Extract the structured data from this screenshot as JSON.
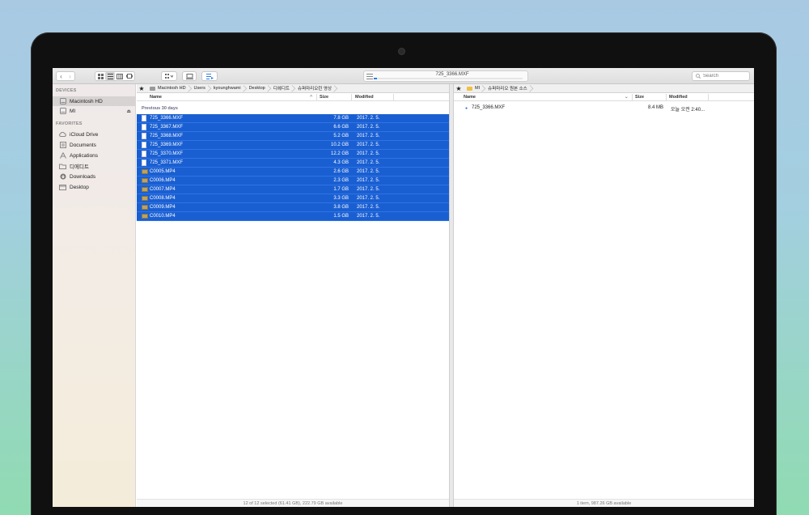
{
  "toolbar": {
    "progress_title": "725_3366.MXF",
    "progress_fraction": 0.02,
    "search_placeholder": "Search"
  },
  "sidebar": {
    "devices_heading": "DEVICES",
    "devices": [
      {
        "label": "Macintosh HD",
        "icon": "hard-drive-icon"
      },
      {
        "label": "MI",
        "icon": "external-drive-icon"
      }
    ],
    "favorites_heading": "FAVORITES",
    "favorites": [
      {
        "label": "iCloud Drive",
        "icon": "cloud-icon"
      },
      {
        "label": "Documents",
        "icon": "document-icon"
      },
      {
        "label": "Applications",
        "icon": "applications-icon"
      },
      {
        "label": "디에디트",
        "icon": "folder-icon"
      },
      {
        "label": "Downloads",
        "icon": "download-icon"
      },
      {
        "label": "Desktop",
        "icon": "desktop-icon"
      }
    ]
  },
  "left_pane": {
    "breadcrumbs": [
      "Macintosh HD",
      "Users",
      "kyounghwami",
      "Desktop",
      "디에디트",
      "슈퍼마리오런 영상"
    ],
    "columns": {
      "name": "Name",
      "size": "Size",
      "modified": "Modified"
    },
    "group_label": "Previous 30 days",
    "files": [
      {
        "name": "725_3366.MXF",
        "size": "7.8 GB",
        "modified": "2017. 2. 5.",
        "type": "mxf"
      },
      {
        "name": "725_3367.MXF",
        "size": "6.6 GB",
        "modified": "2017. 2. 5.",
        "type": "mxf"
      },
      {
        "name": "725_3368.MXF",
        "size": "5.2 GB",
        "modified": "2017. 2. 5.",
        "type": "mxf"
      },
      {
        "name": "725_3369.MXF",
        "size": "10.2 GB",
        "modified": "2017. 2. 5.",
        "type": "mxf"
      },
      {
        "name": "725_3370.MXF",
        "size": "12.2 GB",
        "modified": "2017. 2. 5.",
        "type": "mxf"
      },
      {
        "name": "725_3371.MXF",
        "size": "4.3 GB",
        "modified": "2017. 2. 5.",
        "type": "mxf"
      },
      {
        "name": "C0005.MP4",
        "size": "2.6 GB",
        "modified": "2017. 2. 5.",
        "type": "mp4"
      },
      {
        "name": "C0006.MP4",
        "size": "2.3 GB",
        "modified": "2017. 2. 5.",
        "type": "mp4"
      },
      {
        "name": "C0007.MP4",
        "size": "1.7 GB",
        "modified": "2017. 2. 5.",
        "type": "mp4"
      },
      {
        "name": "C0008.MP4",
        "size": "3.3 GB",
        "modified": "2017. 2. 5.",
        "type": "mp4"
      },
      {
        "name": "C0009.MP4",
        "size": "3.8 GB",
        "modified": "2017. 2. 5.",
        "type": "mp4"
      },
      {
        "name": "C0010.MP4",
        "size": "1.5 GB",
        "modified": "2017. 2. 5.",
        "type": "mp4"
      }
    ],
    "status": "12 of 12 selected (61.41 GB), 222.79 GB available"
  },
  "right_pane": {
    "breadcrumbs": [
      "MI",
      "슈퍼마리오 원본 소스"
    ],
    "columns": {
      "name": "Name",
      "size": "Size",
      "modified": "Modified"
    },
    "files": [
      {
        "name": "725_3366.MXF",
        "size": "8.4 MB",
        "modified": "오늘 오전 2:40..."
      }
    ],
    "status": "1 item, 987.26 GB available"
  },
  "colors": {
    "selection": "#1a5fd2",
    "accent": "#2f7de1"
  }
}
